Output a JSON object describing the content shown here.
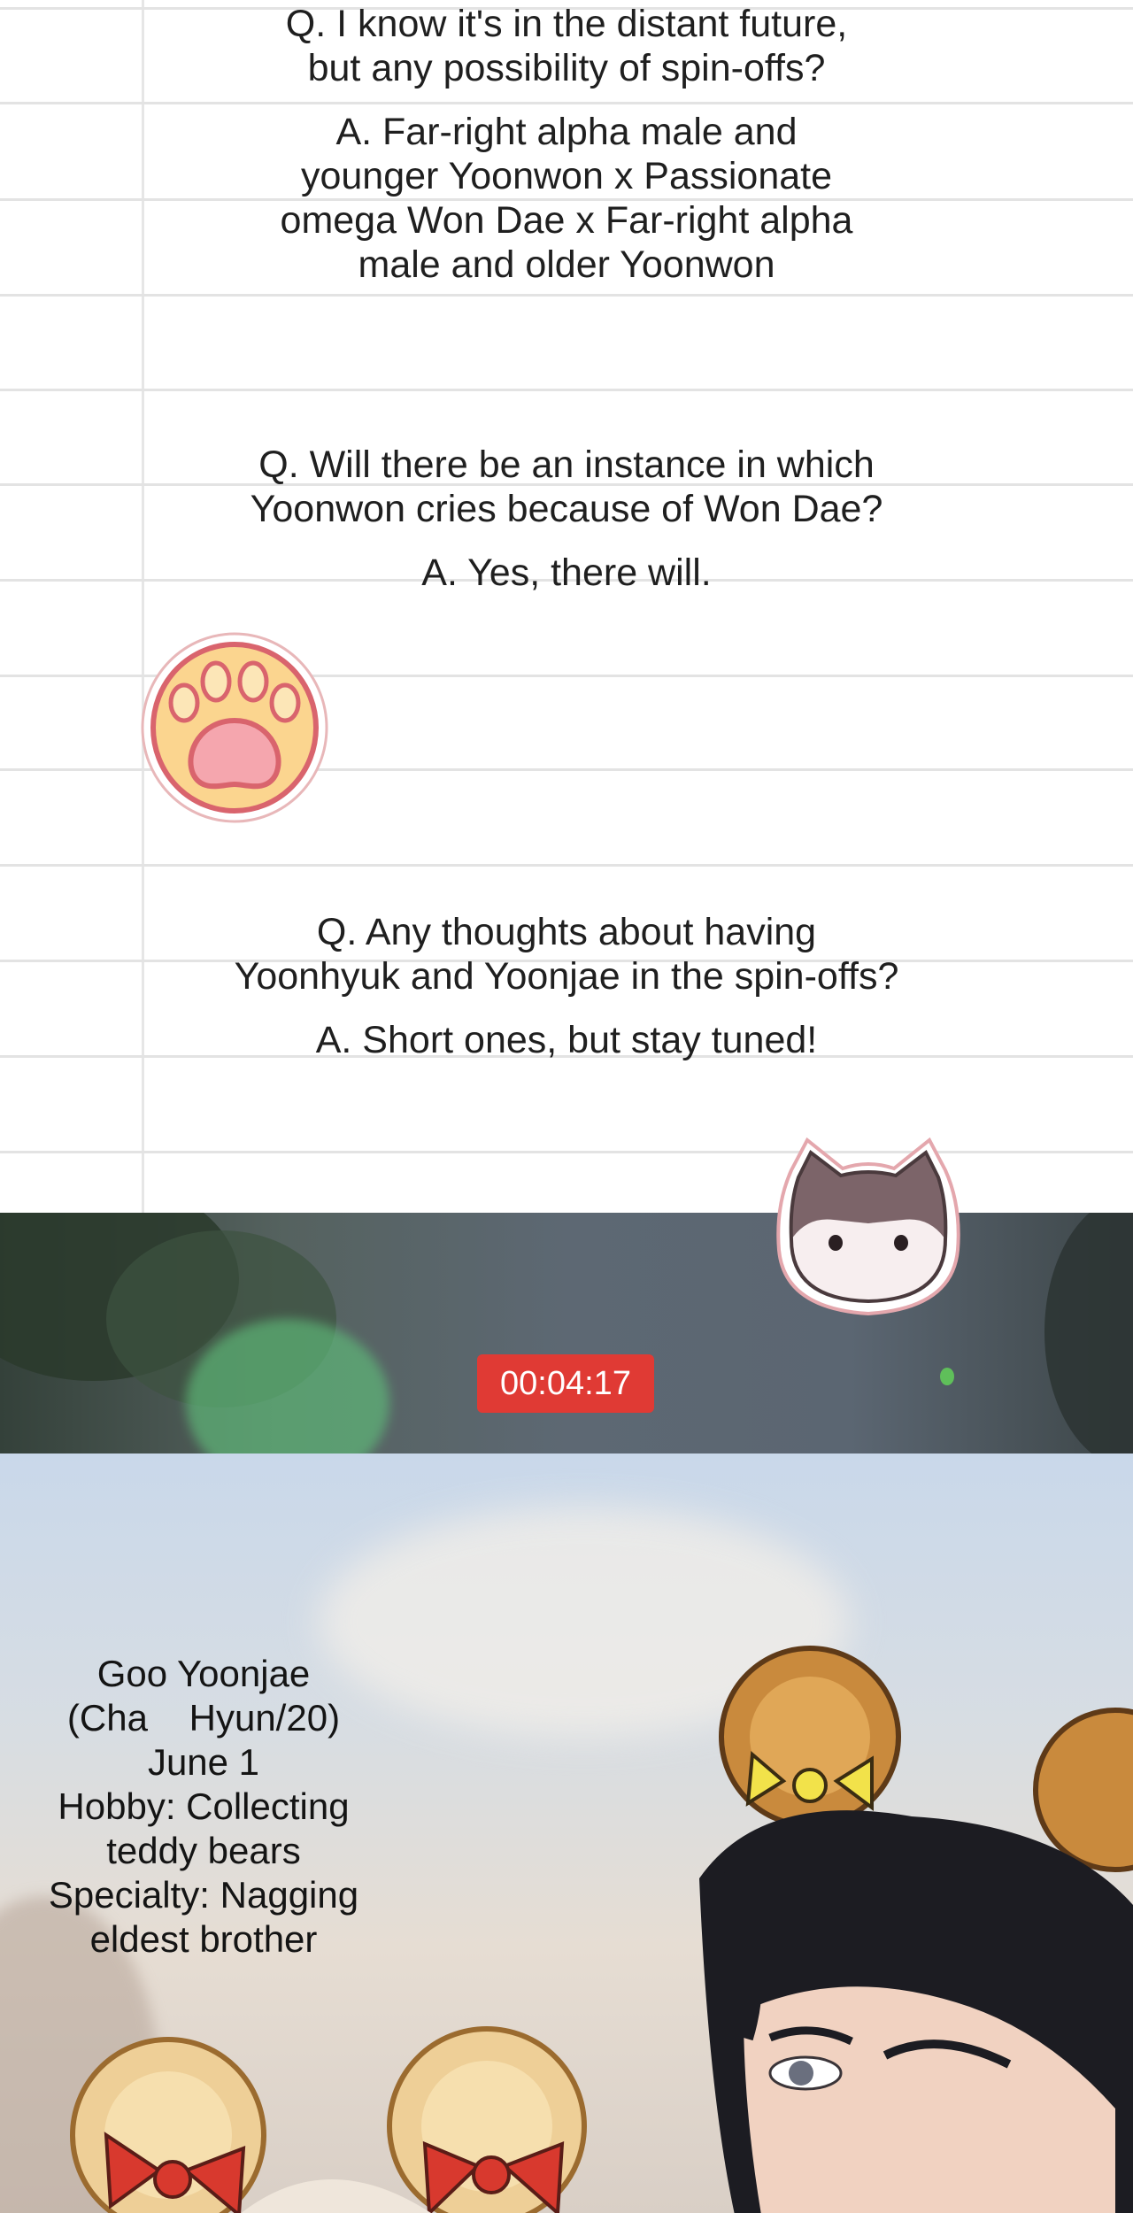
{
  "qa": [
    {
      "question": "Q. I know it's in the distant future,\nbut any possibility of spin-offs?",
      "answer": "A. Far-right alpha male and\nyounger Yoonwon x Passionate\nomega Won Dae x Far-right alpha\nmale and older Yoonwon"
    },
    {
      "question": "Q. Will there be an instance in which\nYoonwon cries because of Won Dae?",
      "answer": "A. Yes, there will."
    },
    {
      "question": "Q. Any thoughts about having\nYoonhyuk and Yoonjae in the spin-offs?",
      "answer": "A. Short ones, but stay tuned!"
    }
  ],
  "stickers": {
    "paw": "paw-sticker-icon",
    "cat": "cat-face-sticker-icon"
  },
  "video": {
    "timestamp": "00:04:17",
    "badge_color": "#e03a34"
  },
  "profile": {
    "text": "Goo Yoonjae\n(Cha    Hyun/20)\nJune 1\nHobby: Collecting\nteddy bears\nSpecialty: Nagging\neldest brother"
  },
  "colors": {
    "paper_rule": "#e3e3e3",
    "paw_pink": "#f39aa6",
    "paw_fill": "#fbd58f",
    "bow_red": "#d8392e",
    "bow_yellow": "#f2e24a"
  }
}
